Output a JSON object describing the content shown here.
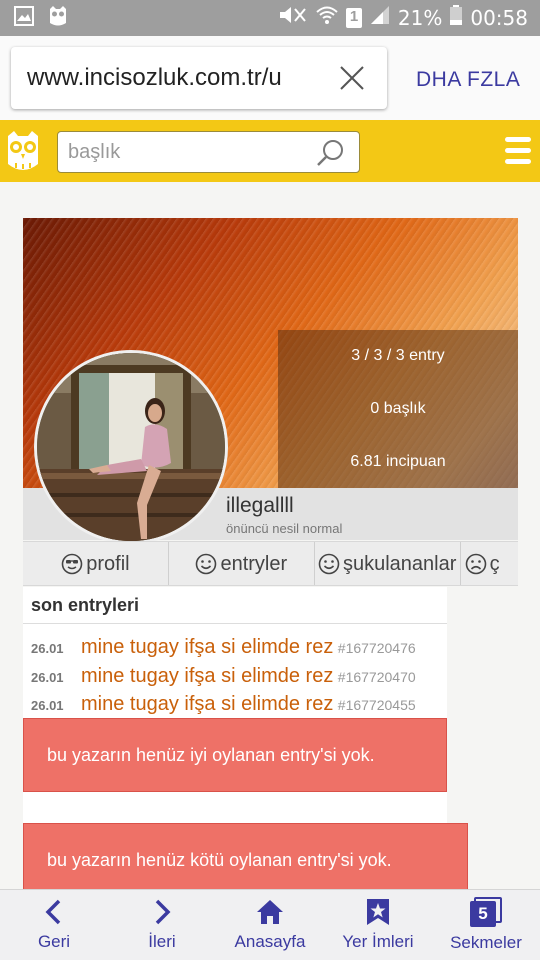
{
  "status_bar": {
    "battery_percent": "21%",
    "time": "00:58",
    "sim_slot": "1",
    "icons": [
      "image-icon",
      "owl-notification-icon",
      "mute-icon",
      "wifi-icon",
      "signal-icon",
      "battery-icon"
    ]
  },
  "browser": {
    "url": "www.incisozluk.com.tr/u",
    "more_label": "DHA FZLA"
  },
  "site": {
    "search_placeholder": "başlık",
    "brand_color": "#f3c815"
  },
  "profile": {
    "stats": [
      "3 / 3 / 3 entry",
      "0 başlık",
      "6.81 incipuan"
    ],
    "username": "illegallll",
    "user_title": "önüncü nesil normal"
  },
  "tabs": [
    {
      "label": "profil",
      "icon": "cool-face-icon"
    },
    {
      "label": "entryler",
      "icon": "smile-icon"
    },
    {
      "label": "şukulananlar",
      "icon": "smile-icon"
    },
    {
      "label": "ç",
      "icon": "sad-face-icon"
    }
  ],
  "entries": {
    "title": "son entryleri",
    "items": [
      {
        "date": "26.01",
        "title": "mine tugay ifşa si elimde rez",
        "id": "#167720476"
      },
      {
        "date": "26.01",
        "title": "mine tugay ifşa si elimde rez",
        "id": "#167720470"
      },
      {
        "date": "26.01",
        "title": "mine tugay ifşa si elimde rez",
        "id": "#167720455"
      }
    ]
  },
  "alerts": {
    "good": "bu yazarın henüz iyi oylanan entry'si yok.",
    "bad": "bu yazarın henüz kötü oylanan entry'si yok."
  },
  "toolbar": {
    "back": "Geri",
    "forward": "İleri",
    "home": "Anasayfa",
    "bookmarks": "Yer İmleri",
    "tabs": "Sekmeler",
    "tab_count": "5",
    "accent_color": "#3b3aa0"
  }
}
